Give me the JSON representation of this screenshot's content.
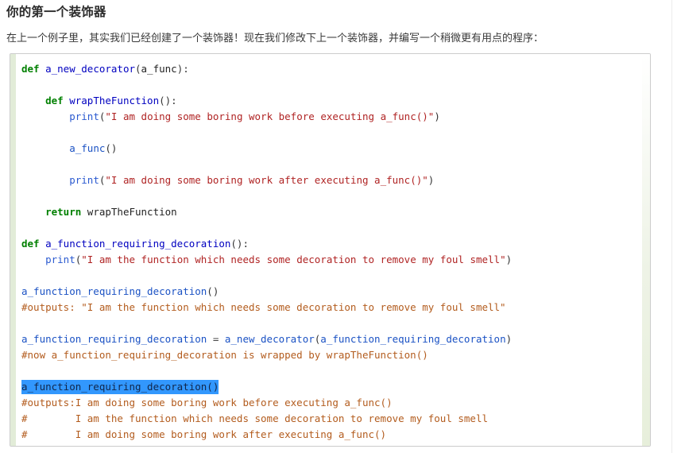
{
  "article": {
    "title": "你的第一个装饰器",
    "intro": "在上一个例子里，其实我们已经创建了一个装饰器！现在我们修改下上一个装饰器，并编写一个稍微更有用点的程序："
  },
  "code_block": {
    "language": "python",
    "selected_line_text": "a_function_requiring_decoration()",
    "colors": {
      "keyword": "#008000",
      "function_name": "#0000c0",
      "builtin": "#2b5ad0",
      "string": "#b02424",
      "comment": "#b35c1e",
      "selection_background": "#3297fd",
      "block_border": "#cccccc",
      "block_accent": "#e2ecd8"
    },
    "lines": [
      {
        "id": "l1",
        "tokens": [
          {
            "t": "def ",
            "c": "k"
          },
          {
            "t": "a_new_decorator",
            "c": "nf"
          },
          {
            "t": "(",
            "c": "p"
          },
          {
            "t": "a_func",
            "c": "n"
          },
          {
            "t": "):",
            "c": "p"
          }
        ]
      },
      {
        "id": "l2",
        "tokens": [
          {
            "t": "",
            "c": "n"
          }
        ]
      },
      {
        "id": "l3",
        "tokens": [
          {
            "t": "    def ",
            "c": "k"
          },
          {
            "t": "wrapTheFunction",
            "c": "nf"
          },
          {
            "t": "():",
            "c": "p"
          }
        ]
      },
      {
        "id": "l4",
        "tokens": [
          {
            "t": "        ",
            "c": "p"
          },
          {
            "t": "print",
            "c": "nb"
          },
          {
            "t": "(",
            "c": "p"
          },
          {
            "t": "\"I am doing some boring work before executing a_func()\"",
            "c": "s"
          },
          {
            "t": ")",
            "c": "p"
          }
        ]
      },
      {
        "id": "l5",
        "tokens": [
          {
            "t": "",
            "c": "n"
          }
        ]
      },
      {
        "id": "l6",
        "tokens": [
          {
            "t": "        ",
            "c": "p"
          },
          {
            "t": "a_func",
            "c": "nv"
          },
          {
            "t": "()",
            "c": "p"
          }
        ]
      },
      {
        "id": "l7",
        "tokens": [
          {
            "t": "",
            "c": "n"
          }
        ]
      },
      {
        "id": "l8",
        "tokens": [
          {
            "t": "        ",
            "c": "p"
          },
          {
            "t": "print",
            "c": "nb"
          },
          {
            "t": "(",
            "c": "p"
          },
          {
            "t": "\"I am doing some boring work after executing a_func()\"",
            "c": "s"
          },
          {
            "t": ")",
            "c": "p"
          }
        ]
      },
      {
        "id": "l9",
        "tokens": [
          {
            "t": "",
            "c": "n"
          }
        ]
      },
      {
        "id": "l10",
        "tokens": [
          {
            "t": "    return ",
            "c": "k"
          },
          {
            "t": "wrapTheFunction",
            "c": "n"
          }
        ]
      },
      {
        "id": "l11",
        "tokens": [
          {
            "t": "",
            "c": "n"
          }
        ]
      },
      {
        "id": "l12",
        "tokens": [
          {
            "t": "def ",
            "c": "k"
          },
          {
            "t": "a_function_requiring_decoration",
            "c": "nf"
          },
          {
            "t": "():",
            "c": "p"
          }
        ]
      },
      {
        "id": "l13",
        "tokens": [
          {
            "t": "    ",
            "c": "p"
          },
          {
            "t": "print",
            "c": "nb"
          },
          {
            "t": "(",
            "c": "p"
          },
          {
            "t": "\"I am the function which needs some decoration to remove my foul smell\"",
            "c": "s"
          },
          {
            "t": ")",
            "c": "p"
          }
        ]
      },
      {
        "id": "l14",
        "tokens": [
          {
            "t": "",
            "c": "n"
          }
        ]
      },
      {
        "id": "l15",
        "tokens": [
          {
            "t": "a_function_requiring_decoration",
            "c": "nv"
          },
          {
            "t": "()",
            "c": "p"
          }
        ]
      },
      {
        "id": "l16",
        "tokens": [
          {
            "t": "#outputs: \"I am the function which needs some decoration to remove my foul smell\"",
            "c": "c"
          }
        ]
      },
      {
        "id": "l17",
        "tokens": [
          {
            "t": "",
            "c": "n"
          }
        ]
      },
      {
        "id": "l18",
        "tokens": [
          {
            "t": "a_function_requiring_decoration",
            "c": "nv"
          },
          {
            "t": " = ",
            "c": "o"
          },
          {
            "t": "a_new_decorator",
            "c": "nv"
          },
          {
            "t": "(",
            "c": "p"
          },
          {
            "t": "a_function_requiring_decoration",
            "c": "nv"
          },
          {
            "t": ")",
            "c": "p"
          }
        ]
      },
      {
        "id": "l19",
        "tokens": [
          {
            "t": "#now a_function_requiring_decoration is wrapped by wrapTheFunction()",
            "c": "c"
          }
        ]
      },
      {
        "id": "l20",
        "tokens": [
          {
            "t": "",
            "c": "n"
          }
        ]
      },
      {
        "id": "l21",
        "selected": true,
        "tokens": [
          {
            "t": "a_function_requiring_decoration",
            "c": "nv"
          },
          {
            "t": "()",
            "c": "p"
          }
        ]
      },
      {
        "id": "l22",
        "tokens": [
          {
            "t": "#outputs:I am doing some boring work before executing a_func()",
            "c": "c"
          }
        ]
      },
      {
        "id": "l23",
        "tokens": [
          {
            "t": "#        I am the function which needs some decoration to remove my foul smell",
            "c": "c"
          }
        ]
      },
      {
        "id": "l24",
        "tokens": [
          {
            "t": "#        I am doing some boring work after executing a_func()",
            "c": "c"
          }
        ]
      }
    ]
  }
}
